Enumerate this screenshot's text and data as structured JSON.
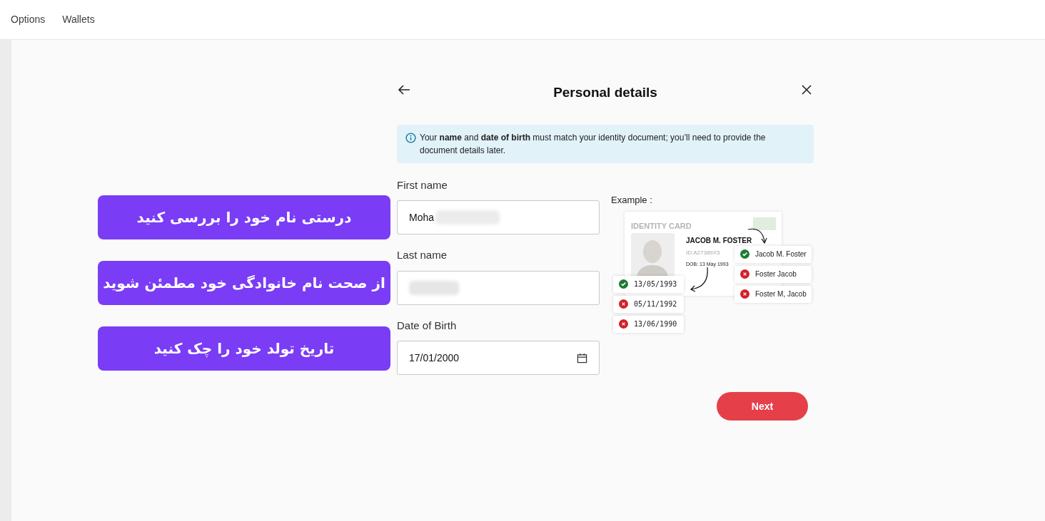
{
  "nav": {
    "items": [
      {
        "label": "Options"
      },
      {
        "label": "Wallets"
      }
    ]
  },
  "dialog": {
    "title": "Personal details",
    "notice": "Your **name** and **date of birth** must match your identity document; you’ll need to provide the document details later.",
    "fields": [
      {
        "label": "First name",
        "value": "Moha",
        "redacted": true,
        "kind": "text"
      },
      {
        "label": "Last name",
        "redacted": true,
        "kind": "text"
      },
      {
        "label": "Date of Birth",
        "value": "17/01/2000",
        "redacted": false,
        "kind": "date"
      }
    ],
    "example": {
      "label": "Example :",
      "card_title": "IDENTITY CARD",
      "card_name": "JACOB M. FOSTER",
      "card_id": "ID:A27389X5",
      "card_dob": "DOB: 13 May 1993",
      "name_options": [
        {
          "text": "Jacob M. Foster",
          "valid": true
        },
        {
          "text": "Foster Jacob",
          "valid": false
        },
        {
          "text": "Foster M, Jacob",
          "valid": false
        }
      ],
      "date_options": [
        {
          "text": "13/05/1993",
          "valid": true
        },
        {
          "text": "05/11/1992",
          "valid": false
        },
        {
          "text": "13/06/1990",
          "valid": false
        }
      ]
    },
    "next_button": "Next"
  },
  "annotations": [
    "درستی نام خود را بررسی کنید",
    "از صحت نام خانوادگی خود مطمئن شوید",
    "تاریخ تولد خود را چک کنید"
  ]
}
